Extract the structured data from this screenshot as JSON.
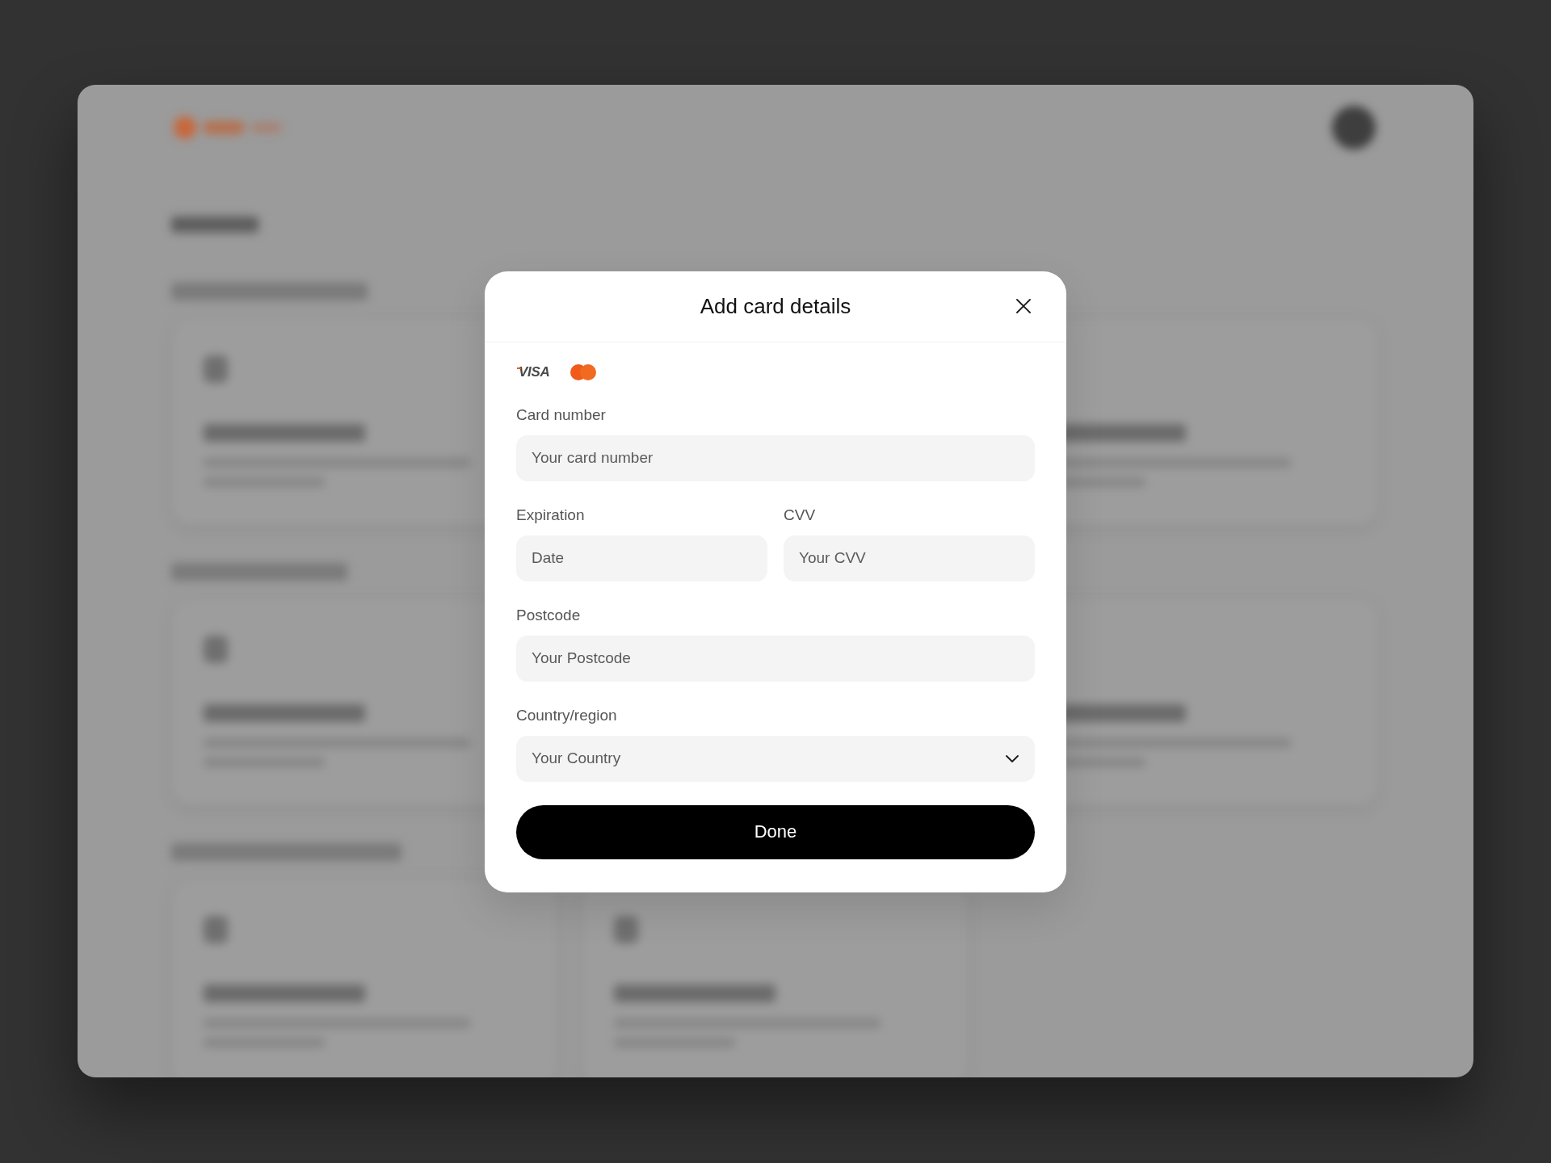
{
  "dialog": {
    "title": "Add card details"
  },
  "card_brands": [
    {
      "kind": "visa",
      "label": "VISA"
    },
    {
      "kind": "mastercard"
    }
  ],
  "rows": [
    {
      "fields": [
        {
          "kind": "text",
          "label": "Card number",
          "placeholder": "Your card number"
        }
      ]
    },
    {
      "fields": [
        {
          "kind": "text",
          "label": "Expiration",
          "placeholder": "Date"
        },
        {
          "kind": "text",
          "label": "CVV",
          "placeholder": "Your CVV"
        }
      ]
    },
    {
      "fields": [
        {
          "kind": "text",
          "label": "Postcode",
          "placeholder": "Your Postcode"
        }
      ]
    },
    {
      "fields": [
        {
          "kind": "select",
          "label": "Country/region",
          "placeholder": "Your Country"
        }
      ]
    }
  ],
  "submit_button": {
    "label": "Done"
  }
}
